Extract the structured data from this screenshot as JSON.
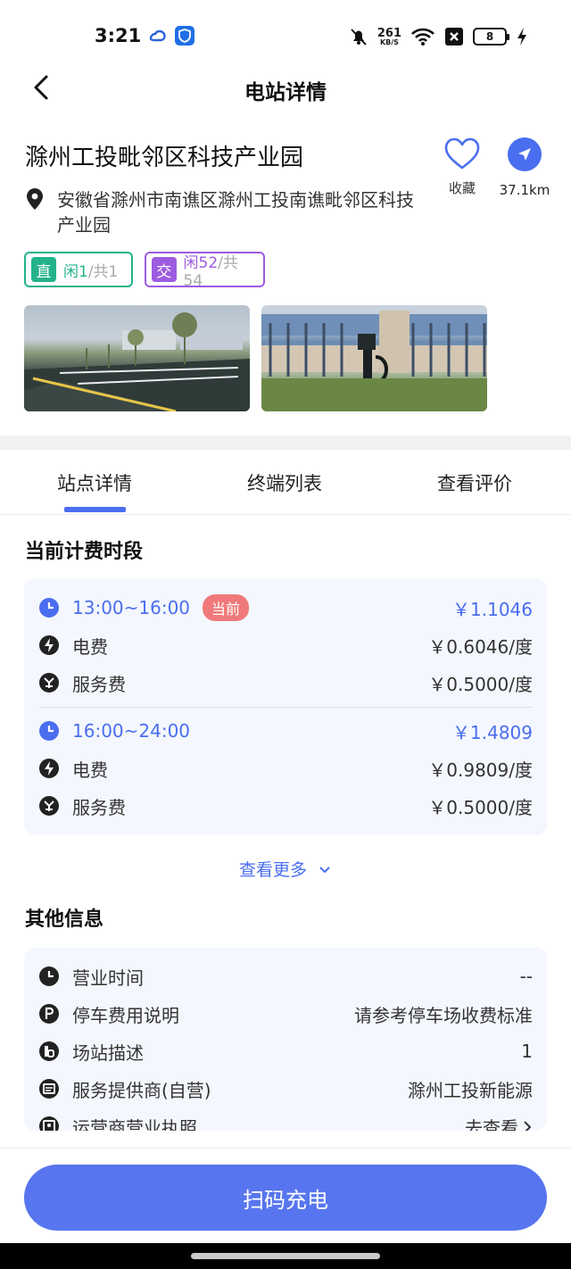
{
  "status_bar": {
    "time": "3:21",
    "net_speed_value": "261",
    "net_speed_unit": "KB/S",
    "battery": "8",
    "icons": [
      "cloud-app-icon",
      "shield-app-icon",
      "bell-muted-icon",
      "wifi-icon",
      "sim-blocked-icon",
      "charging-bolt-icon"
    ]
  },
  "header": {
    "title": "电站详情",
    "back_icon": "chevron-left-icon"
  },
  "station": {
    "name": "滁州工投毗邻区科技产业园",
    "address": "安徽省滁州市南谯区滁州工投南谯毗邻区科技产业园",
    "favorite_label": "收藏",
    "distance": "37.1km"
  },
  "tags": {
    "dc": {
      "badge": "直",
      "free": "闲1",
      "total": "/共1"
    },
    "ac": {
      "badge": "交",
      "free": "闲52",
      "total": "/共54"
    }
  },
  "tabs": [
    "站点详情",
    "终端列表",
    "查看评价"
  ],
  "active_tab": 0,
  "pricing": {
    "section_title": "当前计费时段",
    "periods": [
      {
        "time": "13:00~16:00",
        "badge": "当前",
        "total": "￥1.1046",
        "electricity_label": "电费",
        "electricity_value": "￥0.6046/度",
        "service_label": "服务费",
        "service_value": "￥0.5000/度"
      },
      {
        "time": "16:00~24:00",
        "badge": "",
        "total": "￥1.4809",
        "electricity_label": "电费",
        "electricity_value": "￥0.9809/度",
        "service_label": "服务费",
        "service_value": "￥0.5000/度"
      }
    ],
    "see_more": "查看更多"
  },
  "other_info": {
    "section_title": "其他信息",
    "rows": [
      {
        "icon": "clock-icon",
        "label": "营业时间",
        "value": "--"
      },
      {
        "icon": "parking-icon",
        "label": "停车费用说明",
        "value": "请参考停车场收费标准"
      },
      {
        "icon": "station-desc-icon",
        "label": "场站描述",
        "value": "1"
      },
      {
        "icon": "provider-icon",
        "label": "服务提供商(自营)",
        "value": "滁州工投新能源"
      },
      {
        "icon": "license-icon",
        "label": "运营商营业执照",
        "value": "去查看"
      }
    ]
  },
  "action": {
    "scan_label": "扫码充电"
  },
  "colors": {
    "accent": "#4a6ef0",
    "dc_green": "#23b28b",
    "ac_purple": "#9c5be0",
    "current_badge": "#f07a7a",
    "card_bg": "#f4f7fd"
  }
}
